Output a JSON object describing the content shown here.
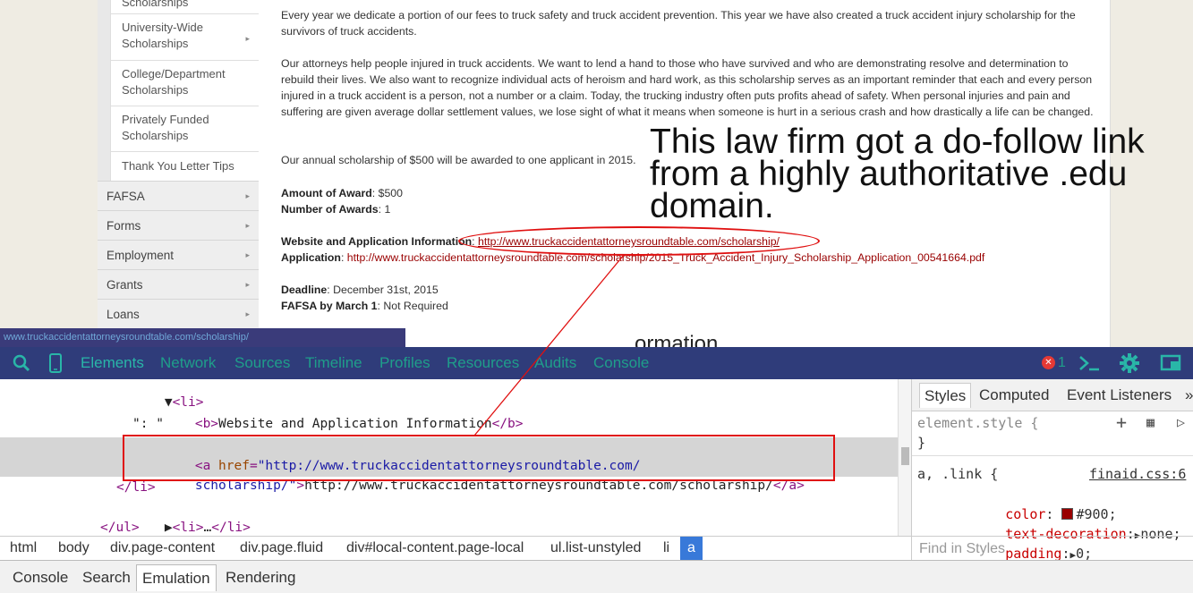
{
  "sidebar": {
    "top_partial": "Scholarships",
    "sub_items": [
      {
        "label": "University-Wide Scholarships",
        "has_arrow": true
      },
      {
        "label": "College/Department Scholarships",
        "has_arrow": false
      },
      {
        "label": "Privately Funded Scholarships",
        "has_arrow": false
      },
      {
        "label": "Thank You Letter Tips",
        "has_arrow": false
      }
    ],
    "main_items": [
      "FAFSA",
      "Forms",
      "Employment",
      "Grants",
      "Loans"
    ],
    "arrow_glyph": "▸"
  },
  "content": {
    "p1": "Every year we dedicate a portion of our fees to truck safety and truck accident prevention. This year we have also created a truck accident injury scholarship for the survivors of truck accidents.",
    "p2": "Our attorneys help people injured in truck accidents. We want to lend a hand to those who have survived and who are demonstrating resolve and determination to rebuild their lives. We also want to recognize individual acts of heroism and hard work, as this scholarship serves as an important reminder that each and every person injured in a truck accident is a person, not a number or a claim. Today, the trucking industry often puts profits ahead of safety. When personal injuries and pain and suffering are given average dollar settlement values, we lose sight of what it means when someone is hurt in a serious crash and how drastically a life can be changed.",
    "p3": "Our annual scholarship of $500 will be awarded to one applicant in 2015.",
    "amount_label": "Amount of Award",
    "amount_value": ": $500",
    "number_label": "Number of Awards",
    "number_value": ": 1",
    "website_label": "Website and Application Information",
    "website_sep": ": ",
    "website_url": "http://www.truckaccidentattorneysroundtable.com/scholarship/",
    "application_label": "Application",
    "application_sep": ": ",
    "application_url": "http://www.truckaccidentattorneysroundtable.com/scholarship/2015_Truck_Accident_Injury_Scholarship_Application_00541664.pdf",
    "deadline_label": "Deadline",
    "deadline_value": ": December 31st, 2015",
    "fafsa_label": "FAFSA by March 1",
    "fafsa_value": ": Not Required",
    "section_peek": "ormation"
  },
  "annotation": {
    "text": "This law firm got a do-follow link from a highly authoritative .edu domain.",
    "color": "#e01010"
  },
  "status_bar": {
    "url": "www.truckaccidentattorneysroundtable.com/scholarship/"
  },
  "devtools": {
    "toolbar": {
      "tabs": [
        "Elements",
        "Network",
        "Sources",
        "Timeline",
        "Profiles",
        "Resources",
        "Audits",
        "Console"
      ],
      "active_tab": "Elements",
      "error_count": "1",
      "error_glyph": "✕"
    },
    "dom": {
      "li_open": "<li>",
      "b_open": "<b>",
      "b_text": "Website and Application Information",
      "b_close": "</b>",
      "colon_text": "\": \"",
      "a_open": "<a ",
      "href_attr": "href",
      "href_eq": "=",
      "href_value_1": "\"http://www.truckaccidentattorneysroundtable.com/",
      "href_value_2": "scholarship/\"",
      "a_gt": ">",
      "a_text": "http://www.truckaccidentattorneysroundtable.com/scholarship/",
      "a_close": "</a>",
      "li_close": "</li>",
      "li_collapsed_open": "<li>",
      "li_ellipsis": "…",
      "li_collapsed_close": "</li>",
      "ul_close": "</ul>"
    },
    "styles": {
      "tabs": [
        "Styles",
        "Computed",
        "Event Listeners"
      ],
      "more": "»",
      "element_style": "element.style {",
      "close_brace": "}",
      "rule_selector": "a, .link {",
      "rule_source": "finaid.css:6",
      "prop_color": "color",
      "val_color": "#900",
      "swatch_color": "#990000",
      "prop_text_decoration": "text-decoration",
      "val_text_decoration": "none",
      "prop_padding": "padding",
      "val_padding": "0",
      "find_placeholder": "Find in Styles"
    },
    "breadcrumbs": [
      "html",
      "body",
      "div.page-content",
      "div.page.fluid",
      "div#local-content.page-local",
      "ul.list-unstyled",
      "li",
      "a"
    ],
    "drawer_tabs": [
      "Console",
      "Search",
      "Emulation",
      "Rendering"
    ],
    "drawer_active": "Emulation"
  }
}
